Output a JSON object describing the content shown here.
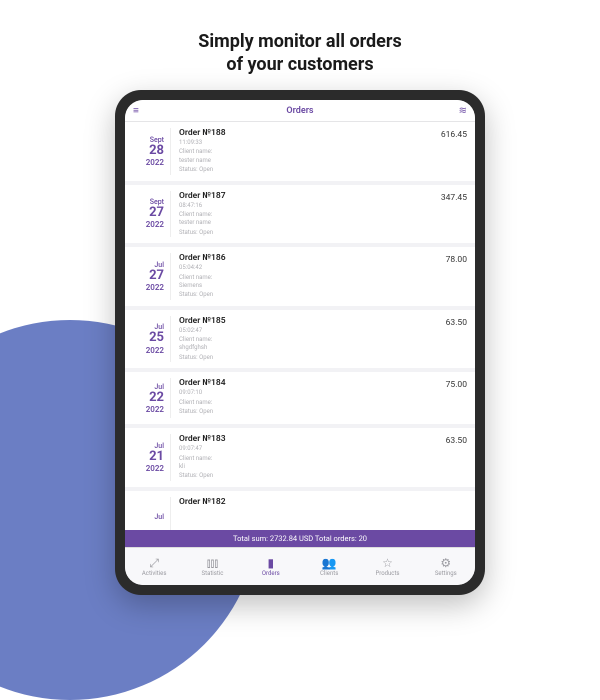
{
  "promo": {
    "line1": "Simply monitor all orders",
    "line2": "of your customers"
  },
  "header": {
    "title": "Orders"
  },
  "orders": [
    {
      "num": "Order №188",
      "time": "11:09:33",
      "client_label": "Client name:",
      "client": "tester name",
      "status_label": "Status:",
      "status": "Open",
      "month": "Sept",
      "day": "28",
      "year": "2022",
      "amount": "616.45"
    },
    {
      "num": "Order №187",
      "time": "08:47:16",
      "client_label": "Client name:",
      "client": "tester name",
      "status_label": "Status:",
      "status": "Open",
      "month": "Sept",
      "day": "27",
      "year": "2022",
      "amount": "347.45"
    },
    {
      "num": "Order №186",
      "time": "05:04:42",
      "client_label": "Client name:",
      "client": "Siemens",
      "status_label": "Status:",
      "status": "Open",
      "month": "Jul",
      "day": "27",
      "year": "2022",
      "amount": "78.00"
    },
    {
      "num": "Order №185",
      "time": "05:02:47",
      "client_label": "Client name:",
      "client": "shgdfghsh",
      "status_label": "Status:",
      "status": "Open",
      "month": "Jul",
      "day": "25",
      "year": "2022",
      "amount": "63.50"
    },
    {
      "num": "Order №184",
      "time": "09:07:10",
      "client_label": "Client name:",
      "client": "",
      "status_label": "Status:",
      "status": "Open",
      "month": "Jul",
      "day": "22",
      "year": "2022",
      "amount": "75.00"
    },
    {
      "num": "Order №183",
      "time": "09:07:47",
      "client_label": "Client name:",
      "client": "kli",
      "status_label": "Status:",
      "status": "Open",
      "month": "Jul",
      "day": "21",
      "year": "2022",
      "amount": "63.50"
    },
    {
      "num": "Order №182",
      "time": "",
      "client_label": "",
      "client": "",
      "status_label": "",
      "status": "",
      "month": "Jul",
      "day": "",
      "year": "",
      "amount": ""
    }
  ],
  "summary": "Total sum: 2732.84 USD Total orders: 20",
  "tabs": [
    {
      "label": "Activities",
      "icon": "⤢"
    },
    {
      "label": "Statistic",
      "icon": "⫾⫾⫾"
    },
    {
      "label": "Orders",
      "icon": "▮"
    },
    {
      "label": "Clients",
      "icon": "👥"
    },
    {
      "label": "Products",
      "icon": "☆"
    },
    {
      "label": "Settings",
      "icon": "⚙"
    }
  ]
}
